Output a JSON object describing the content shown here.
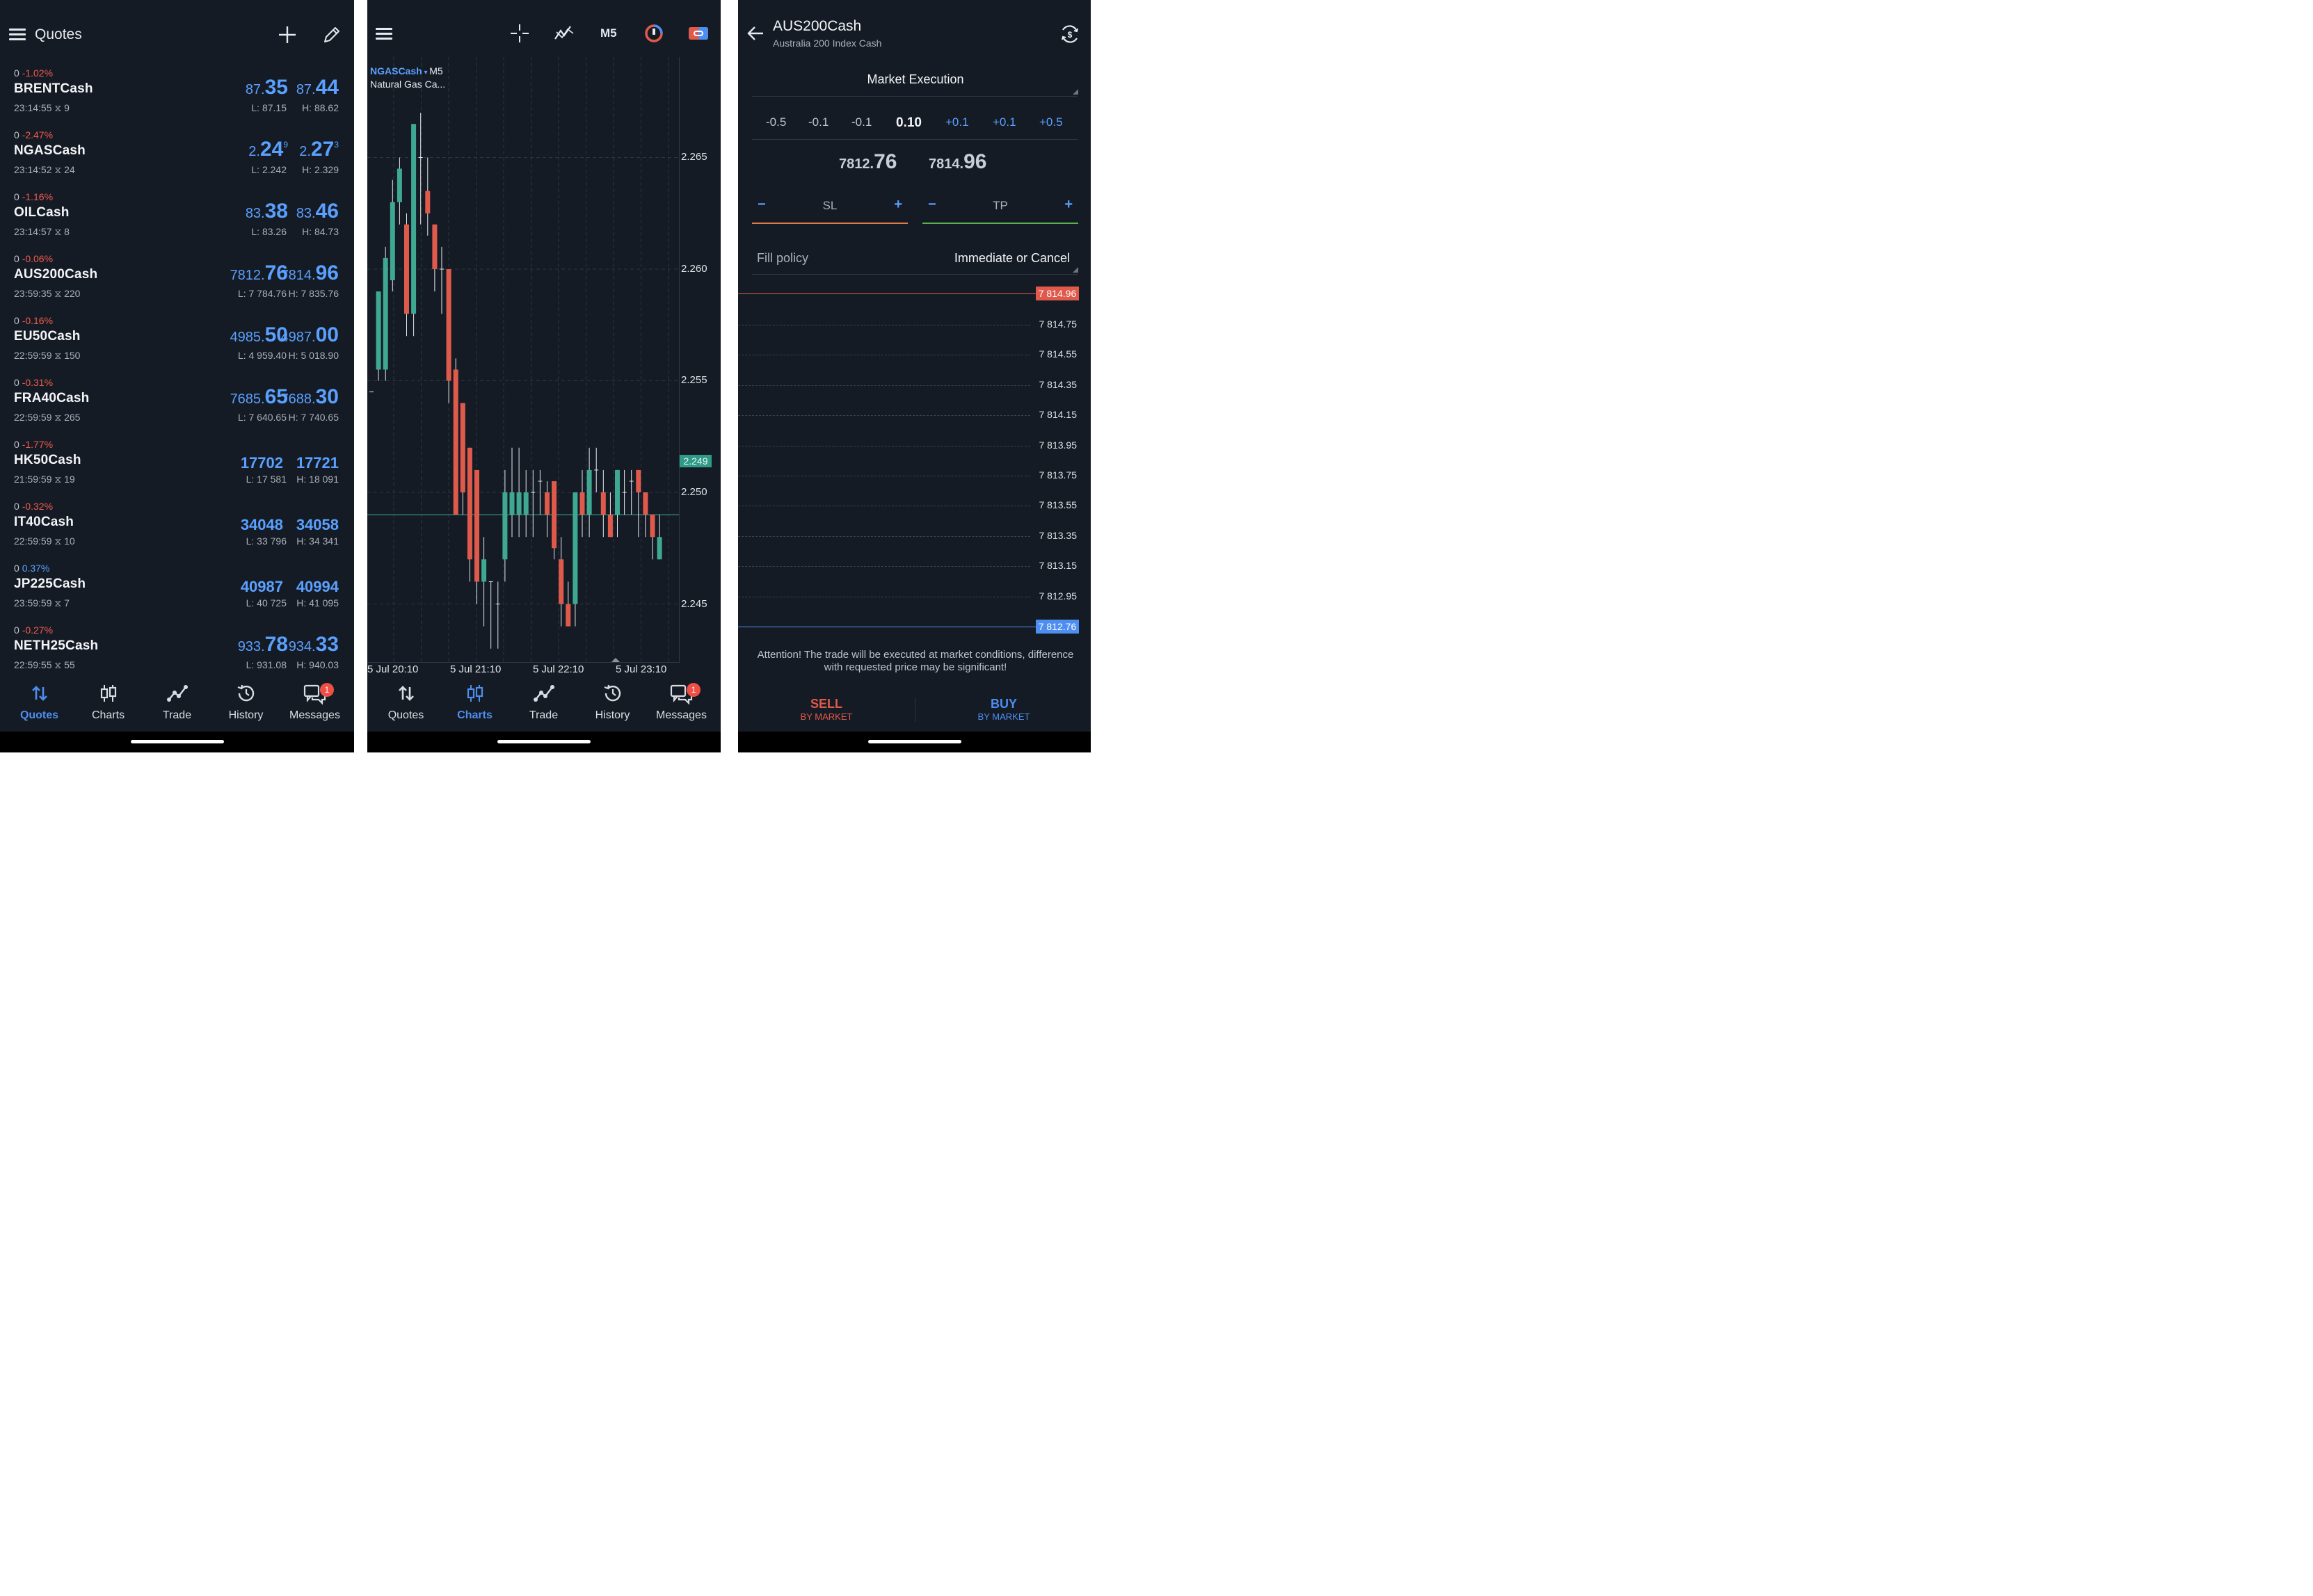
{
  "quotes_screen": {
    "title": "Quotes",
    "rows": [
      {
        "spread": "0",
        "change": "-1.02%",
        "symbol": "BRENTCash",
        "time": "23:14:55",
        "ticks": "9",
        "bid_small": "87.",
        "bid_big": "35",
        "bid_sup": "",
        "ask_small": "87.",
        "ask_big": "44",
        "ask_sup": "",
        "low": "L: 87.15",
        "high": "H: 88.62"
      },
      {
        "spread": "0",
        "change": "-2.47%",
        "symbol": "NGASCash",
        "time": "23:14:52",
        "ticks": "24",
        "bid_small": "2.",
        "bid_big": "24",
        "bid_sup": "9",
        "ask_small": "2.",
        "ask_big": "27",
        "ask_sup": "3",
        "low": "L: 2.242",
        "high": "H: 2.329"
      },
      {
        "spread": "0",
        "change": "-1.16%",
        "symbol": "OILCash",
        "time": "23:14:57",
        "ticks": "8",
        "bid_small": "83.",
        "bid_big": "38",
        "bid_sup": "",
        "ask_small": "83.",
        "ask_big": "46",
        "ask_sup": "",
        "low": "L: 83.26",
        "high": "H: 84.73"
      },
      {
        "spread": "0",
        "change": "-0.06%",
        "symbol": "AUS200Cash",
        "time": "23:59:35",
        "ticks": "220",
        "bid_small": "7812.",
        "bid_big": "76",
        "bid_sup": "",
        "ask_small": "7814.",
        "ask_big": "96",
        "ask_sup": "",
        "low": "L: 7 784.76",
        "high": "H: 7 835.76"
      },
      {
        "spread": "0",
        "change": "-0.16%",
        "symbol": "EU50Cash",
        "time": "22:59:59",
        "ticks": "150",
        "bid_small": "4985.",
        "bid_big": "50",
        "bid_sup": "",
        "ask_small": "4987.",
        "ask_big": "00",
        "ask_sup": "",
        "low": "L: 4 959.40",
        "high": "H: 5 018.90"
      },
      {
        "spread": "0",
        "change": "-0.31%",
        "symbol": "FRA40Cash",
        "time": "22:59:59",
        "ticks": "265",
        "bid_small": "7685.",
        "bid_big": "65",
        "bid_sup": "",
        "ask_small": "7688.",
        "ask_big": "30",
        "ask_sup": "",
        "low": "L: 7 640.65",
        "high": "H: 7 740.65"
      },
      {
        "spread": "0",
        "change": "-1.77%",
        "symbol": "HK50Cash",
        "time": "21:59:59",
        "ticks": "19",
        "bid_small": "17702",
        "bid_big": "",
        "bid_sup": "",
        "ask_small": "17721",
        "ask_big": "",
        "ask_sup": "",
        "low": "L: 17 581",
        "high": "H: 18 091"
      },
      {
        "spread": "0",
        "change": "-0.32%",
        "symbol": "IT40Cash",
        "time": "22:59:59",
        "ticks": "10",
        "bid_small": "34048",
        "bid_big": "",
        "bid_sup": "",
        "ask_small": "34058",
        "ask_big": "",
        "ask_sup": "",
        "low": "L: 33 796",
        "high": "H: 34 341"
      },
      {
        "spread": "0",
        "change": "0.37%",
        "symbol": "JP225Cash",
        "time": "23:59:59",
        "ticks": "7",
        "bid_small": "40987",
        "bid_big": "",
        "bid_sup": "",
        "ask_small": "40994",
        "ask_big": "",
        "ask_sup": "",
        "low": "L: 40 725",
        "high": "H: 41 095"
      },
      {
        "spread": "0",
        "change": "-0.27%",
        "symbol": "NETH25Cash",
        "time": "22:59:55",
        "ticks": "55",
        "bid_small": "933.",
        "bid_big": "78",
        "bid_sup": "",
        "ask_small": "934.",
        "ask_big": "33",
        "ask_sup": "",
        "low": "L: 931.08",
        "high": "H: 940.03"
      }
    ]
  },
  "nav": {
    "quotes": "Quotes",
    "charts": "Charts",
    "trade": "Trade",
    "history": "History",
    "messages": "Messages",
    "messages_badge": "1"
  },
  "chart_screen": {
    "timeframe": "M5",
    "symbol": "NGASCash",
    "symbol_tf": "M5",
    "description": "Natural Gas Ca...",
    "current_price": "2.249",
    "colors": {
      "up": "#3fa893",
      "down": "#e05a4c"
    }
  },
  "chart_data": {
    "type": "candlestick",
    "y_ticks": [
      "2.265",
      "2.260",
      "2.255",
      "2.250",
      "2.245"
    ],
    "x_ticks": [
      "5 Jul 20:10",
      "5 Jul 21:10",
      "5 Jul 22:10",
      "5 Jul 23:10"
    ],
    "ylim": [
      2.2424,
      2.2695
    ],
    "current": 2.249,
    "candles": [
      {
        "o": 2.2545,
        "c": 2.2545,
        "h": 2.2545,
        "l": 2.2545
      },
      {
        "o": 2.2555,
        "c": 2.259,
        "h": 2.259,
        "l": 2.255
      },
      {
        "o": 2.2555,
        "c": 2.2605,
        "h": 2.261,
        "l": 2.255
      },
      {
        "o": 2.2595,
        "c": 2.263,
        "h": 2.264,
        "l": 2.259
      },
      {
        "o": 2.263,
        "c": 2.2645,
        "h": 2.265,
        "l": 2.262
      },
      {
        "o": 2.262,
        "c": 2.258,
        "h": 2.2625,
        "l": 2.257
      },
      {
        "o": 2.258,
        "c": 2.2665,
        "h": 2.2665,
        "l": 2.257
      },
      {
        "o": 2.265,
        "c": 2.265,
        "h": 2.267,
        "l": 2.262
      },
      {
        "o": 2.2635,
        "c": 2.2625,
        "h": 2.265,
        "l": 2.2615
      },
      {
        "o": 2.262,
        "c": 2.26,
        "h": 2.262,
        "l": 2.259
      },
      {
        "o": 2.26,
        "c": 2.26,
        "h": 2.261,
        "l": 2.258
      },
      {
        "o": 2.26,
        "c": 2.255,
        "h": 2.26,
        "l": 2.254
      },
      {
        "o": 2.2555,
        "c": 2.249,
        "h": 2.256,
        "l": 2.249
      },
      {
        "o": 2.254,
        "c": 2.25,
        "h": 2.254,
        "l": 2.249
      },
      {
        "o": 2.252,
        "c": 2.247,
        "h": 2.252,
        "l": 2.246
      },
      {
        "o": 2.251,
        "c": 2.246,
        "h": 2.251,
        "l": 2.245
      },
      {
        "o": 2.246,
        "c": 2.247,
        "h": 2.248,
        "l": 2.244
      },
      {
        "o": 2.246,
        "c": 2.246,
        "h": 2.246,
        "l": 2.243
      },
      {
        "o": 2.245,
        "c": 2.245,
        "h": 2.246,
        "l": 2.243
      },
      {
        "o": 2.247,
        "c": 2.25,
        "h": 2.251,
        "l": 2.246
      },
      {
        "o": 2.249,
        "c": 2.25,
        "h": 2.252,
        "l": 2.248
      },
      {
        "o": 2.249,
        "c": 2.25,
        "h": 2.252,
        "l": 2.248
      },
      {
        "o": 2.249,
        "c": 2.25,
        "h": 2.251,
        "l": 2.248
      },
      {
        "o": 2.25,
        "c": 2.25,
        "h": 2.251,
        "l": 2.248
      },
      {
        "o": 2.2505,
        "c": 2.2505,
        "h": 2.251,
        "l": 2.249
      },
      {
        "o": 2.25,
        "c": 2.249,
        "h": 2.2505,
        "l": 2.248
      },
      {
        "o": 2.2505,
        "c": 2.2475,
        "h": 2.2505,
        "l": 2.247
      },
      {
        "o": 2.247,
        "c": 2.245,
        "h": 2.248,
        "l": 2.244
      },
      {
        "o": 2.245,
        "c": 2.244,
        "h": 2.246,
        "l": 2.244
      },
      {
        "o": 2.245,
        "c": 2.25,
        "h": 2.25,
        "l": 2.244
      },
      {
        "o": 2.25,
        "c": 2.249,
        "h": 2.251,
        "l": 2.248
      },
      {
        "o": 2.249,
        "c": 2.251,
        "h": 2.252,
        "l": 2.248
      },
      {
        "o": 2.251,
        "c": 2.251,
        "h": 2.252,
        "l": 2.25
      },
      {
        "o": 2.25,
        "c": 2.249,
        "h": 2.251,
        "l": 2.248
      },
      {
        "o": 2.249,
        "c": 2.248,
        "h": 2.25,
        "l": 2.248
      },
      {
        "o": 2.249,
        "c": 2.251,
        "h": 2.251,
        "l": 2.248
      },
      {
        "o": 2.25,
        "c": 2.25,
        "h": 2.251,
        "l": 2.249
      },
      {
        "o": 2.2505,
        "c": 2.2505,
        "h": 2.251,
        "l": 2.249
      },
      {
        "o": 2.251,
        "c": 2.25,
        "h": 2.251,
        "l": 2.248
      },
      {
        "o": 2.25,
        "c": 2.249,
        "h": 2.25,
        "l": 2.248
      },
      {
        "o": 2.249,
        "c": 2.248,
        "h": 2.249,
        "l": 2.247
      },
      {
        "o": 2.247,
        "c": 2.248,
        "h": 2.249,
        "l": 2.247
      }
    ]
  },
  "order_screen": {
    "symbol": "AUS200Cash",
    "description": "Australia 200 Index Cash",
    "execution": "Market Execution",
    "volume_steps": [
      "-0.5",
      "-0.1",
      "-0.1",
      "0.10",
      "+0.1",
      "+0.1",
      "+0.5"
    ],
    "sell_small": "7812.",
    "sell_big": "76",
    "buy_small": "7814.",
    "buy_big": "96",
    "sl_label": "SL",
    "tp_label": "TP",
    "minus": "−",
    "plus": "+",
    "fill_label": "Fill policy",
    "fill_value": "Immediate or Cancel",
    "ask_tag": "7 814.96",
    "bid_tag": "7 812.76",
    "levels": [
      "7 814.75",
      "7 814.55",
      "7 814.35",
      "7 814.15",
      "7 813.95",
      "7 813.75",
      "7 813.55",
      "7 813.35",
      "7 813.15",
      "7 812.95"
    ],
    "warning": "Attention! The trade will be executed at market conditions, difference with requested price may be significant!",
    "sell_label": "SELL",
    "sell_sub": "BY MARKET",
    "buy_label": "BUY",
    "buy_sub": "BY MARKET",
    "colors": {
      "sell": "#e05a4c",
      "buy": "#4d8ef0",
      "sl": "#e07a4c",
      "tp": "#5ab04c"
    }
  }
}
